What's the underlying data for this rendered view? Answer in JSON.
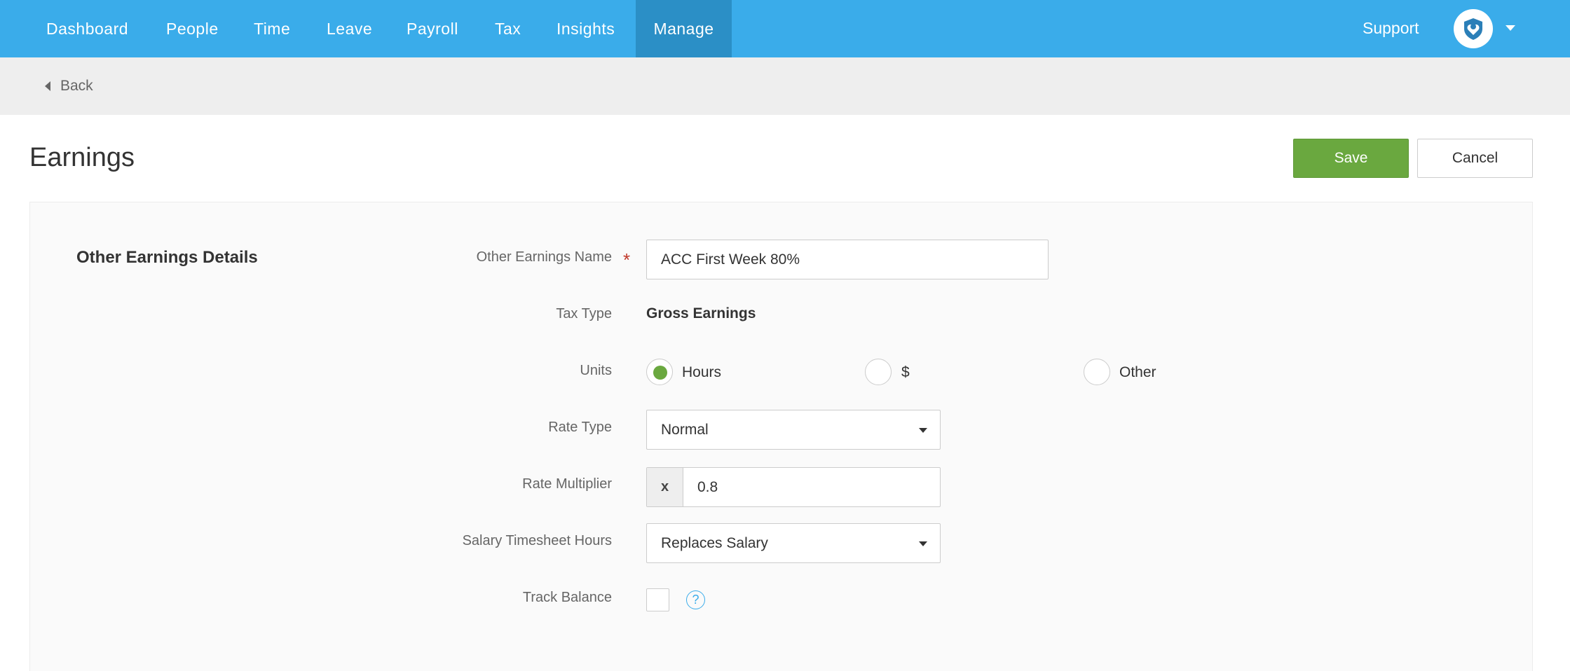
{
  "nav": {
    "items": [
      {
        "label": "Dashboard"
      },
      {
        "label": "People"
      },
      {
        "label": "Time"
      },
      {
        "label": "Leave"
      },
      {
        "label": "Payroll"
      },
      {
        "label": "Tax"
      },
      {
        "label": "Insights"
      },
      {
        "label": "Manage",
        "active": true
      }
    ],
    "support_label": "Support",
    "avatar_icon": "shield-heart-icon",
    "brand_color": "#3aacea",
    "active_color": "#2b8fc6"
  },
  "backbar": {
    "back_label": "Back"
  },
  "page": {
    "title": "Earnings",
    "save_label": "Save",
    "cancel_label": "Cancel",
    "save_color": "#6aa83f"
  },
  "form": {
    "section_title": "Other Earnings Details",
    "name": {
      "label": "Other Earnings Name",
      "required_mark": "*",
      "value": "ACC First Week 80%"
    },
    "tax_type": {
      "label": "Tax Type",
      "value": "Gross Earnings"
    },
    "units": {
      "label": "Units",
      "options": [
        {
          "label": "Hours",
          "checked": true
        },
        {
          "label": "$",
          "checked": false
        },
        {
          "label": "Other",
          "checked": false
        }
      ]
    },
    "rate_type": {
      "label": "Rate Type",
      "value": "Normal"
    },
    "rate_multiplier": {
      "label": "Rate Multiplier",
      "prefix": "x",
      "value": "0.8"
    },
    "salary_timesheet_hours": {
      "label": "Salary Timesheet Hours",
      "value": "Replaces Salary"
    },
    "track_balance": {
      "label": "Track Balance",
      "checked": false,
      "help_icon": "question-circle-icon",
      "help_glyph": "?"
    }
  }
}
